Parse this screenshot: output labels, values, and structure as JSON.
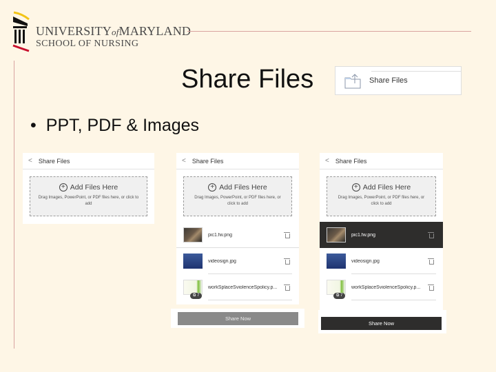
{
  "branding": {
    "line1_a": "UNIVERSITY",
    "line1_of": "of",
    "line1_b": "MARYLAND",
    "line2": "SCHOOL OF NURSING"
  },
  "slide": {
    "title": "Share Files",
    "bullet": "PPT, PDF & Images"
  },
  "menu_item": {
    "icon": "folder-upload-icon",
    "label": "Share Files"
  },
  "panels": [
    {
      "header": "Share Files",
      "drop": {
        "title": "Add Files Here",
        "hint": "Drag Images, PowerPoint, or PDF files here, or click to add"
      }
    },
    {
      "header": "Share Files",
      "drop": {
        "title": "Add Files Here",
        "hint": "Drag Images, PowerPoint, or PDF files here, or click to add"
      },
      "files": [
        {
          "name": "pic1.fw.png",
          "selected": false
        },
        {
          "name": "videosign.jpg",
          "selected": false
        },
        {
          "name": "workSplaceSviolenceSpolicy.p...",
          "badge": "7",
          "selected": false
        }
      ],
      "share_button": "Share Now",
      "share_enabled": false
    },
    {
      "header": "Share Files",
      "drop": {
        "title": "Add Files Here",
        "hint": "Drag Images, PowerPoint, or PDF files here, or click to add"
      },
      "files": [
        {
          "name": "pic1.fw.png",
          "selected": true
        },
        {
          "name": "videosign.jpg",
          "selected": false
        },
        {
          "name": "workSplaceSviolenceSpolicy.p...",
          "badge": "7",
          "selected": false
        }
      ],
      "share_button": "Share Now",
      "share_enabled": true
    }
  ],
  "colors": {
    "background": "#fef6e6",
    "rule": "#d9a3a0",
    "selected_row": "#2e2d2c",
    "button_disabled": "#8a8a8a"
  }
}
